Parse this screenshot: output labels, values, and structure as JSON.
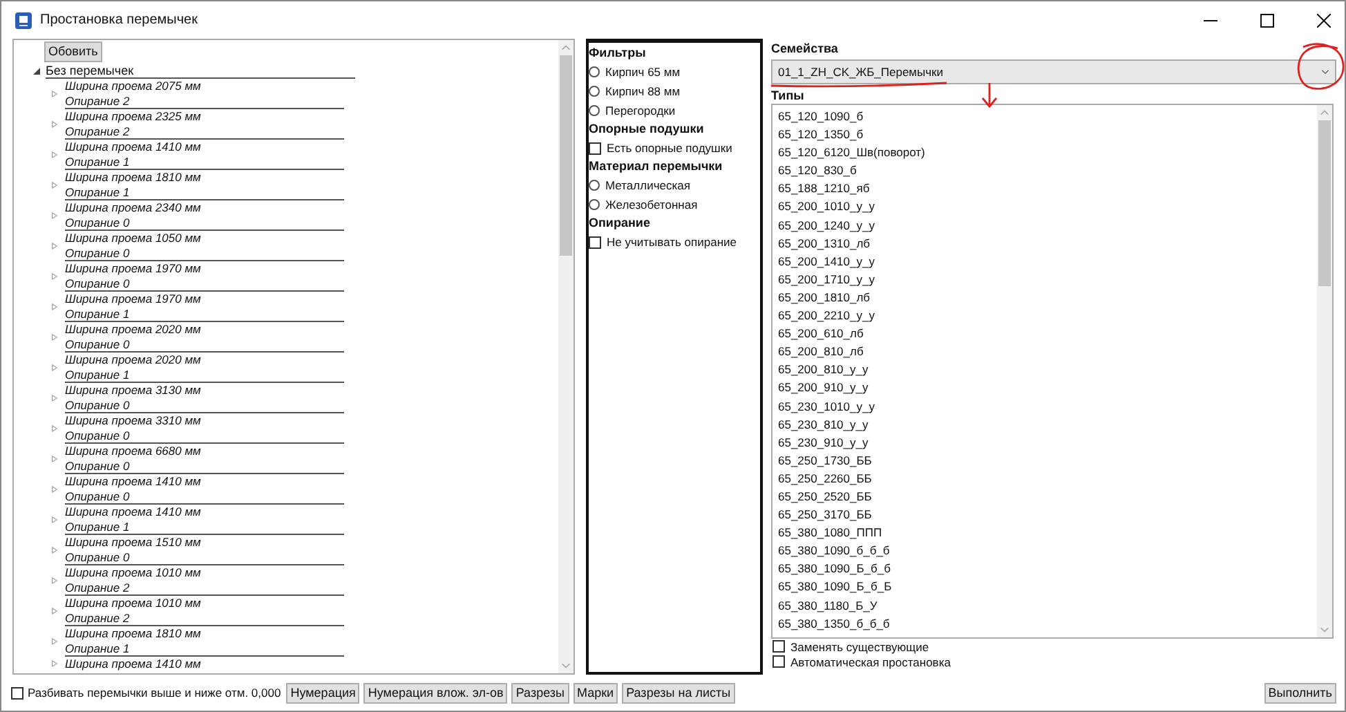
{
  "window": {
    "title": "Простановка перемычек"
  },
  "tree": {
    "refresh_button": "Обовить",
    "root": {
      "label": "Без перемычек",
      "expanded": true,
      "children": [
        {
          "width": "Ширина проема 2075 мм",
          "support": "Опирание 2",
          "expanded": false
        },
        {
          "width": "Ширина проема 2325 мм",
          "support": "Опирание 2",
          "expanded": false
        },
        {
          "width": "Ширина проема 1410 мм",
          "support": "Опирание 1",
          "expanded": false
        },
        {
          "width": "Ширина проема 1810 мм",
          "support": "Опирание 1",
          "expanded": false
        },
        {
          "width": "Ширина проема 2340 мм",
          "support": "Опирание 0",
          "expanded": false
        },
        {
          "width": "Ширина проема 1050 мм",
          "support": "Опирание 0",
          "expanded": false
        },
        {
          "width": "Ширина проема 1970 мм",
          "support": "Опирание 0",
          "expanded": false
        },
        {
          "width": "Ширина проема 1970 мм",
          "support": "Опирание 1",
          "expanded": false
        },
        {
          "width": "Ширина проема 2020 мм",
          "support": "Опирание 0",
          "expanded": false
        },
        {
          "width": "Ширина проема 2020 мм",
          "support": "Опирание 1",
          "expanded": false
        },
        {
          "width": "Ширина проема 3130 мм",
          "support": "Опирание 0",
          "expanded": false
        },
        {
          "width": "Ширина проема 3310 мм",
          "support": "Опирание 0",
          "expanded": false
        },
        {
          "width": "Ширина проема 6680 мм",
          "support": "Опирание 0",
          "expanded": false
        },
        {
          "width": "Ширина проема 1410 мм",
          "support": "Опирание 0",
          "expanded": false
        },
        {
          "width": "Ширина проема 1410 мм",
          "support": "Опирание 1",
          "expanded": false
        },
        {
          "width": "Ширина проема 1510 мм",
          "support": "Опирание 0",
          "expanded": false
        },
        {
          "width": "Ширина проема 1010 мм",
          "support": "Опирание 2",
          "expanded": false
        },
        {
          "width": "Ширина проема 1010 мм",
          "support": "Опирание 2",
          "expanded": false
        },
        {
          "width": "Ширина проема 1810 мм",
          "support": "Опирание 1",
          "expanded": false
        },
        {
          "width": "Ширина проема 1410 мм",
          "expanded": false
        }
      ]
    }
  },
  "filters": [
    {
      "heading": "Фильтры",
      "options": [
        {
          "kind": "radio",
          "label": "Кирпич 65 мм",
          "selected": false
        },
        {
          "kind": "radio",
          "label": "Кирпич 88 мм",
          "selected": false
        },
        {
          "kind": "radio",
          "label": "Перегородки",
          "selected": false
        }
      ]
    },
    {
      "heading": "Опорные подушки",
      "options": [
        {
          "kind": "checkbox",
          "label": "Есть опорные подушки",
          "checked": false
        }
      ]
    },
    {
      "heading": "Материал перемычки",
      "options": [
        {
          "kind": "radio",
          "label": "Металлическая",
          "selected": false
        },
        {
          "kind": "radio",
          "label": "Железобетонная",
          "selected": false
        }
      ]
    },
    {
      "heading": "Опирание",
      "options": [
        {
          "kind": "checkbox",
          "label": "Не учитывать опирание",
          "checked": false
        }
      ]
    }
  ],
  "families": {
    "label": "Семейства",
    "value": "01_1_ZH_CK_ЖБ_Перемычки"
  },
  "types": {
    "label": "Типы",
    "items": [
      "65_120_1090_б",
      "65_120_1350_б",
      "65_120_6120_Шв(поворот)",
      "65_120_830_б",
      "65_188_1210_яб",
      "65_200_1010_у_у",
      "65_200_1240_у_у",
      "65_200_1310_лб",
      "65_200_1410_у_у",
      "65_200_1710_у_у",
      "65_200_1810_лб",
      "65_200_2210_у_у",
      "65_200_610_лб",
      "65_200_810_лб",
      "65_200_810_у_у",
      "65_200_910_у_у",
      "65_230_1010_у_у",
      "65_230_810_у_у",
      "65_230_910_у_у",
      "65_250_1730_ББ",
      "65_250_2260_ББ",
      "65_250_2520_ББ",
      "65_250_3170_ББ",
      "65_380_1080_ППП",
      "65_380_1090_б_б_б",
      "65_380_1090_Б_б_б",
      "65_380_1090_Б_б_Б",
      "65_380_1180_Б_У",
      "65_380_1350_б_б_б"
    ]
  },
  "options": [
    {
      "label": "Заменять существующие",
      "checked": false
    },
    {
      "label": "Автоматическая простановка",
      "checked": false
    }
  ],
  "bottom": {
    "split_option": {
      "label": "Разбивать перемычки выше и ниже отм. 0,000",
      "checked": false
    },
    "buttons": [
      "Нумерация",
      "Нумерация влож. эл-ов",
      "Разрезы",
      "Марки",
      "Разрезы на листы"
    ],
    "run_button": "Выполнить"
  }
}
